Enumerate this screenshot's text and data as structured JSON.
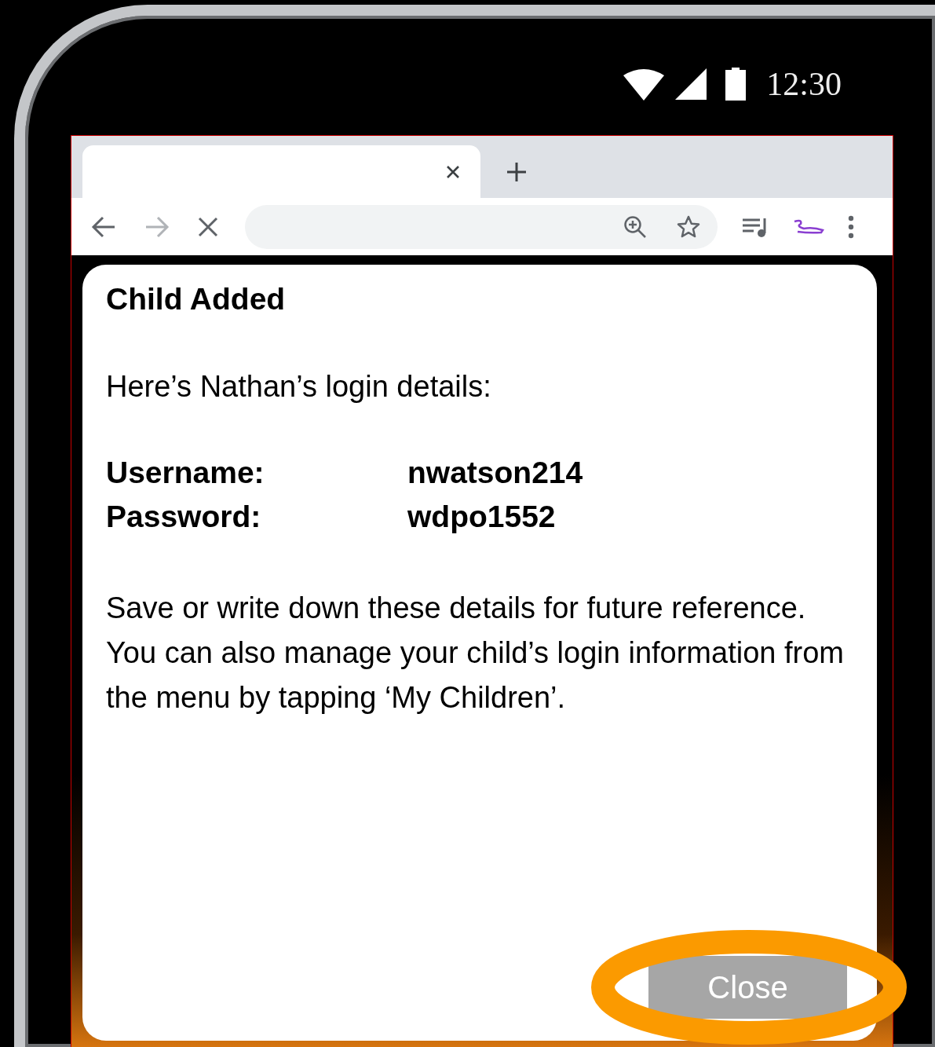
{
  "status_bar": {
    "time": "12:30"
  },
  "browser": {
    "tabs": [
      {
        "selected": true
      }
    ]
  },
  "dialog": {
    "title": "Child Added",
    "intro": "Here’s Nathan’s login details:",
    "fields": [
      {
        "label": "Username:",
        "value": "nwatson214"
      },
      {
        "label": "Password:",
        "value": "wdpo1552"
      }
    ],
    "note": "Save or write down these details for future reference. You can also manage your child’s login information from the menu by tapping ‘My Children’.",
    "close_button": {
      "label": "Close",
      "highlighted": true
    }
  }
}
